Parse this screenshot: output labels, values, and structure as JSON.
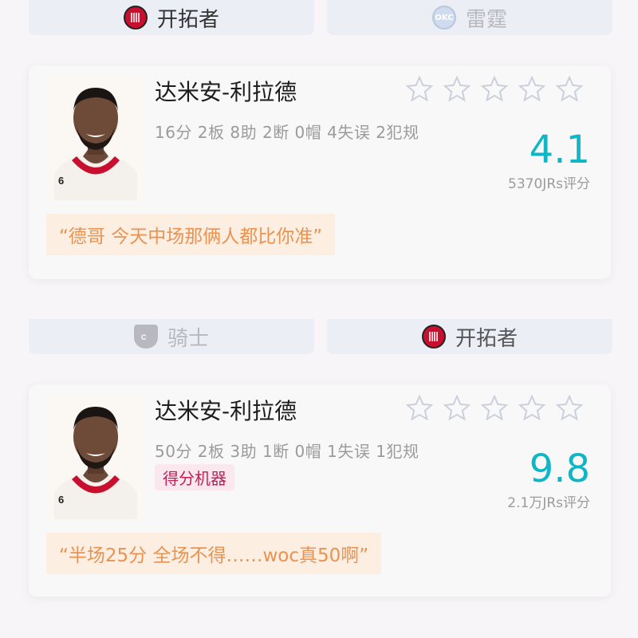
{
  "section1": {
    "tab_left": {
      "team": "开拓者",
      "logo_icon": "blazers-logo-icon"
    },
    "tab_right": {
      "team": "雷霆",
      "logo_icon": "thunder-logo-icon",
      "logo_text": "OKC"
    },
    "card": {
      "player_name": "达米安-利拉德",
      "stats": "16分 2板 8助 2断 0帽 4失误 2犯规",
      "score": "4.1",
      "votes": "5370JRs评分",
      "comment": "“德哥 今天中场那俩人都比你准”",
      "jersey_number": "6",
      "stars_filled": 0,
      "stars_total": 5
    }
  },
  "section2": {
    "tab_left": {
      "team": "骑士",
      "logo_icon": "cavaliers-logo-icon"
    },
    "tab_right": {
      "team": "开拓者",
      "logo_icon": "blazers-logo-icon"
    },
    "card": {
      "player_name": "达米安-利拉德",
      "stats": "50分 2板 3助 1断 0帽 1失误 1犯规",
      "tag": "得分机器",
      "score": "9.8",
      "votes": "2.1万JRs评分",
      "comment": "“半场25分 全场不得……woc真50啊”",
      "jersey_number": "6",
      "stars_filled": 0,
      "stars_total": 5
    }
  },
  "colors": {
    "score": "#0fb7c6",
    "comment_text": "#ea9250",
    "comment_bg": "#fcefe2",
    "tag_text": "#c02055",
    "tag_bg": "#fbe7ee",
    "star_outline": "#c9cfdb"
  }
}
